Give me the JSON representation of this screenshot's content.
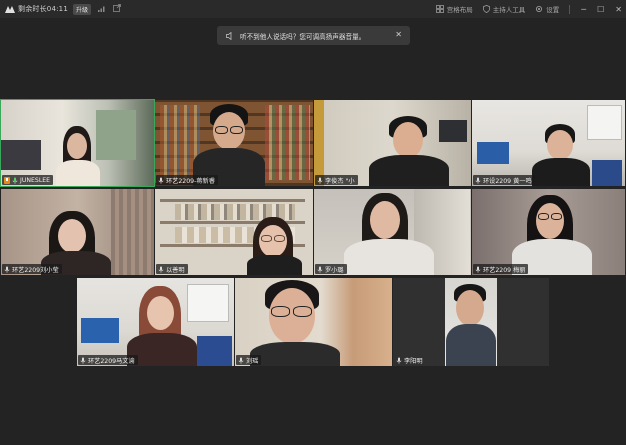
{
  "titlebar": {
    "timer_text": "剩余时长04:11",
    "upgrade_label": "升级",
    "layout_label": "宫格布局",
    "host_tools_label": "主持人工具",
    "settings_label": "设置"
  },
  "toast": {
    "message": "听不到他人说话吗？您可调高扬声器音量。"
  },
  "participants": [
    {
      "name": "JUNESLEE"
    },
    {
      "name": "环艺2209-蒋新睿"
    },
    {
      "name": "李俊杰 \"小"
    },
    {
      "name": "环设2209 黄一鸣"
    },
    {
      "name": "环艺2209刘小莹"
    },
    {
      "name": "以善明"
    },
    {
      "name": "罗小璐"
    },
    {
      "name": "环艺2209 梅丽"
    },
    {
      "name": "环艺2209马文渝"
    },
    {
      "name": "刘瑶"
    },
    {
      "name": "李阳明"
    }
  ],
  "colors": {
    "active_speaker_border": "#3aa85a",
    "background": "#232323"
  }
}
